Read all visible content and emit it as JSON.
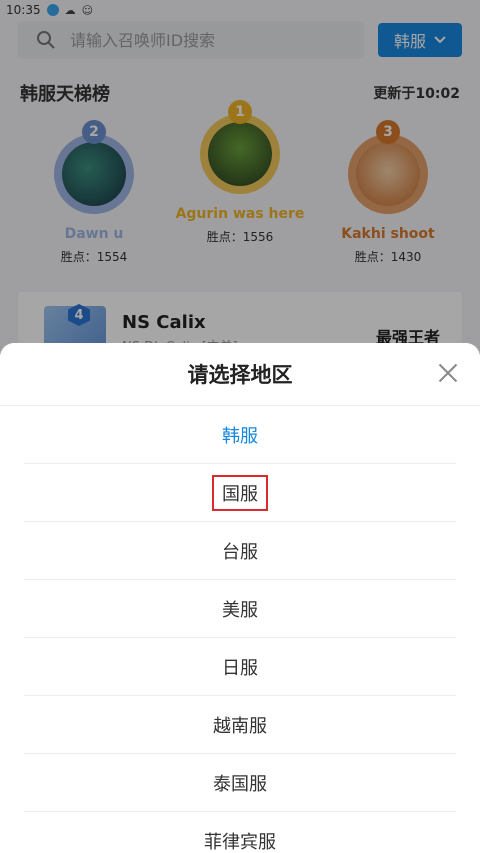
{
  "status_bar": {
    "time": "10:35"
  },
  "search": {
    "placeholder": "请输入召唤师ID搜索",
    "region_button": "韩服"
  },
  "ladder": {
    "title": "韩服天梯榜",
    "updated": "更新于10:02",
    "top3": [
      {
        "rank": "2",
        "name": "Dawn u",
        "score": "胜点：1554",
        "color": "#6a8fd0"
      },
      {
        "rank": "1",
        "name": "Agurin was here",
        "score": "胜点：1556",
        "color": "#f0b228"
      },
      {
        "rank": "3",
        "name": "Kakhi shoot",
        "score": "胜点：1430",
        "color": "#d8792b"
      }
    ],
    "fourth": {
      "rank": "4",
      "name": "NS Calix",
      "sub": "NS DL Calix [中单]",
      "tier": "最强王者"
    }
  },
  "sheet": {
    "title": "请选择地区",
    "options": [
      "韩服",
      "国服",
      "台服",
      "美服",
      "日服",
      "越南服",
      "泰国服",
      "菲律宾服"
    ]
  }
}
